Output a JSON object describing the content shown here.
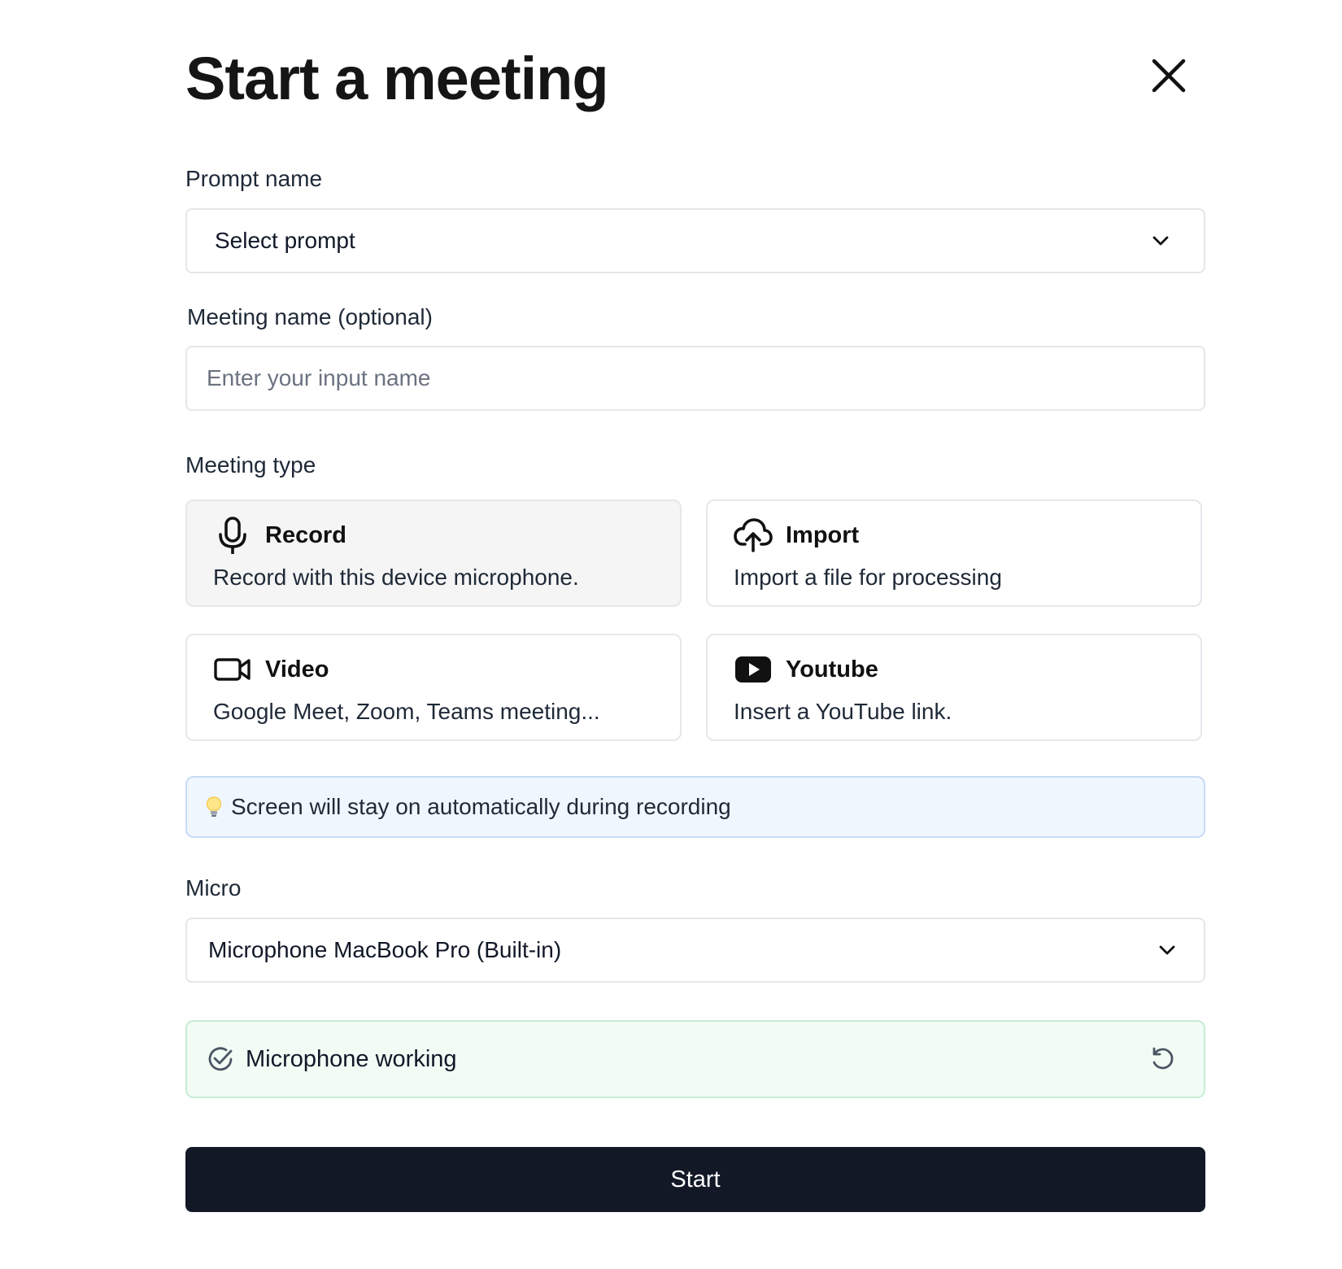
{
  "dialog": {
    "title": "Start a meeting",
    "close_icon": "close-icon"
  },
  "prompt": {
    "label": "Prompt name",
    "selected": "Select prompt"
  },
  "meeting_name": {
    "label": "Meeting name (optional)",
    "value": "",
    "placeholder": "Enter your input name"
  },
  "meeting_type": {
    "label": "Meeting type",
    "selected": "Record",
    "options": [
      {
        "title": "Record",
        "description": "Record with this device microphone.",
        "icon": "microphone-icon"
      },
      {
        "title": "Import",
        "description": "Import a file for processing",
        "icon": "cloud-upload-icon"
      },
      {
        "title": "Video",
        "description": "Google Meet, Zoom, Teams meeting...",
        "icon": "video-camera-icon"
      },
      {
        "title": "Youtube",
        "description": "Insert a YouTube link.",
        "icon": "youtube-icon"
      }
    ]
  },
  "notice": {
    "icon": "lightbulb-icon",
    "text": "Screen will stay on automatically during recording"
  },
  "micro": {
    "label": "Micro",
    "selected": "Microphone MacBook Pro (Built-in)"
  },
  "mic_status": {
    "icon": "check-circle-icon",
    "text": "Microphone working",
    "action_icon": "refresh-icon"
  },
  "start_label": "Start",
  "colors": {
    "primary_button": "#121826",
    "selected_card": "#f5f5f5",
    "notice_bg": "#f0f6fe",
    "notice_border": "#c7dbf5",
    "success_bg": "#f1fcf5",
    "success_border": "#c6ecd3"
  }
}
